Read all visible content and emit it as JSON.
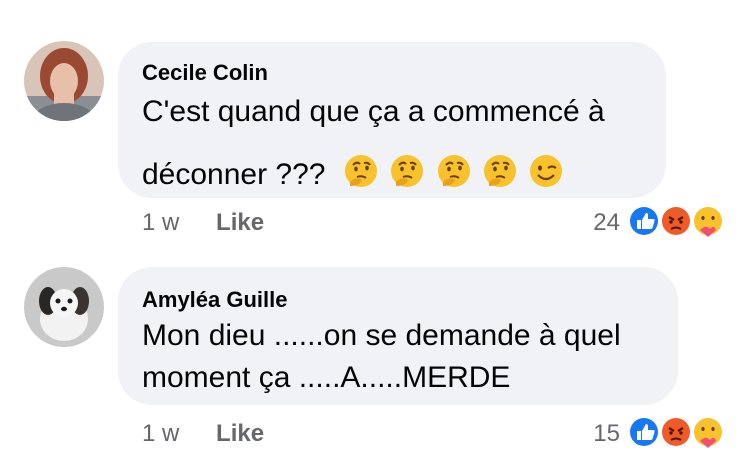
{
  "comments": [
    {
      "author": "Cecile Colin",
      "text_line1": "C'est quand que ça a commencé à",
      "text_line2": "déconner ???",
      "emojis": [
        "thinking-face",
        "thinking-face",
        "thinking-face",
        "thinking-face",
        "winking-face"
      ],
      "time": "1 w",
      "like_label": "Like",
      "reaction_count": "24",
      "reactions": [
        "like",
        "angry",
        "care"
      ]
    },
    {
      "author": "Amyléa Guille",
      "text_line1": "Mon dieu ......on se demande à quel",
      "text_line2": "moment ça .....A.....MERDE",
      "time": "1 w",
      "like_label": "Like",
      "reaction_count": "15",
      "reactions": [
        "like",
        "angry",
        "care"
      ]
    }
  ],
  "colors": {
    "bubble": "#f0f2f5",
    "meta_text": "#65676b",
    "like_blue": "#1877f2",
    "angry_orange": "#f05a28",
    "emoji_yellow": "#f7c22c"
  }
}
